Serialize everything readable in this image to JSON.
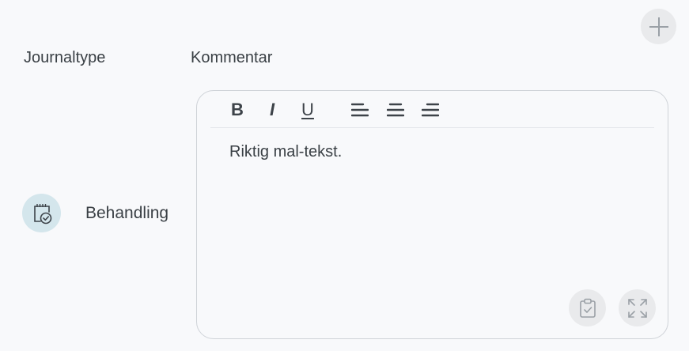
{
  "header": {
    "add_button_icon": "plus-icon",
    "columns": {
      "journaltype": "Journaltype",
      "kommentar": "Kommentar"
    }
  },
  "row": {
    "type_icon": "clipboard-check-icon",
    "type_label": "Behandling",
    "comment_text": "Riktig mal-tekst."
  },
  "toolbar": {
    "bold": "B",
    "italic": "I",
    "underline": "U",
    "align_left_icon": "align-left-icon",
    "align_center_icon": "align-center-icon",
    "align_right_icon": "align-right-icon"
  },
  "editor_actions": {
    "paste_icon": "clipboard-icon",
    "expand_icon": "expand-icon"
  },
  "colors": {
    "background": "#f8f9fb",
    "icon_circle": "#d4e6ec",
    "button_circle": "#e9eaec",
    "border": "#cfd3d8",
    "text": "#3a4045"
  }
}
